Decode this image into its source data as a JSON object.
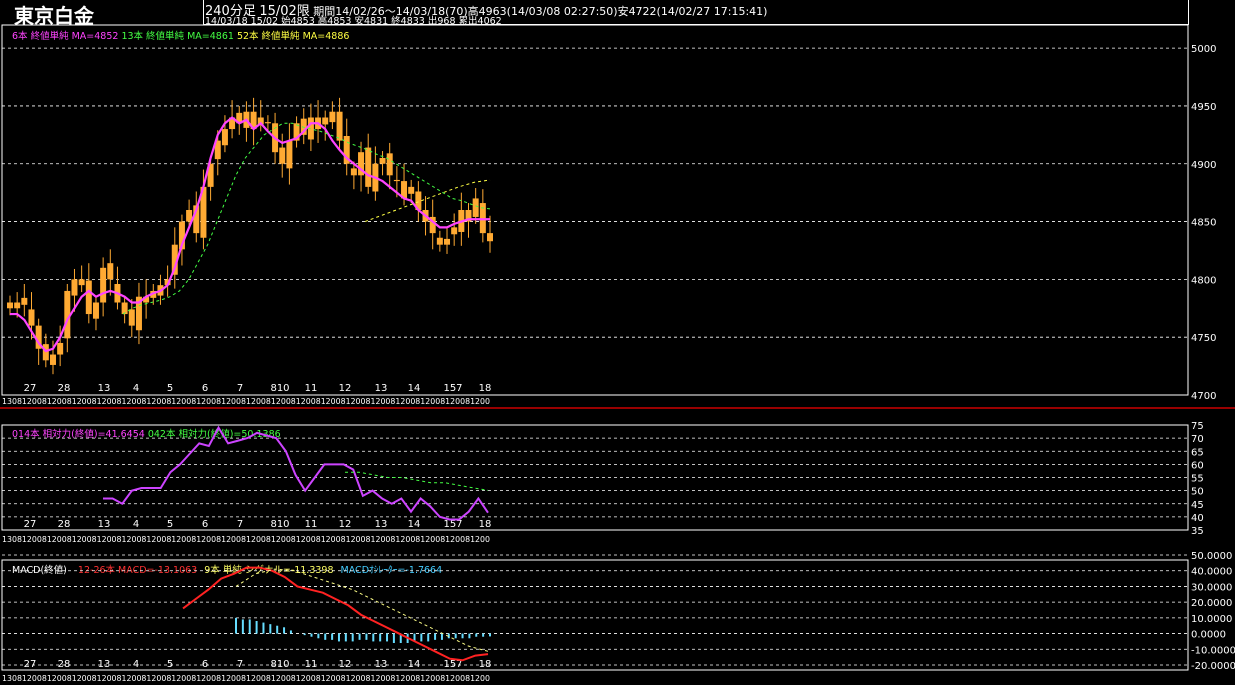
{
  "header": {
    "instrument": "東京白金",
    "timeframe": "240分足",
    "contract": "15/02限",
    "period_info": "期間14/02/26～14/03/18(70)高4963(14/03/08 02:27:50)安4722(14/02/27 17:15:41)",
    "bar_info": "14/03/18 15/02 始4853 高4853 安4831 終4833 出968 累出4062"
  },
  "price_panel": {
    "legend": [
      {
        "text": "6本 終値単純 MA=4852",
        "color": "#ff44ff"
      },
      {
        "text": "13本 終値単純 MA=4861",
        "color": "#44ff44"
      },
      {
        "text": "52本 終値単純 MA=4886",
        "color": "#ffff44"
      }
    ],
    "y_ticks": [
      "5000",
      "4950",
      "4900",
      "4850",
      "4800",
      "4750",
      "4700"
    ]
  },
  "rsi_panel": {
    "legend": [
      {
        "text": "014本 相対力(終値)=41.6454",
        "color": "#ff44ff"
      },
      {
        "text": "042本 相対力(終値)=50.1386",
        "color": "#44ff44"
      }
    ],
    "y_ticks": [
      "75",
      "70",
      "65",
      "60",
      "55",
      "50",
      "45",
      "40",
      "35"
    ]
  },
  "macd_panel": {
    "legend": [
      {
        "text": "MACD(終値)",
        "color": "#ffffff"
      },
      {
        "text": "12-26本 MACD=-13.1063",
        "color": "#ff3333"
      },
      {
        "text": "9本 単純 シグナル=-11.3398",
        "color": "#ffff66"
      },
      {
        "text": "MACDｵｼﾚｰﾀｰ=-1.7664",
        "color": "#44ccff"
      }
    ],
    "y_ticks": [
      "50.0000",
      "40.0000",
      "30.0000",
      "20.0000",
      "10.0000",
      "0.0000",
      "-10.0000",
      "-20.0000"
    ]
  },
  "x_date_labels": [
    "27",
    "28",
    "13",
    "4",
    "5",
    "6",
    "7",
    "810",
    "11",
    "12",
    "13",
    "14",
    "157",
    "18"
  ],
  "x_time_strip": "13081200812008120081200812008120081200812008120081200812008120081200812008120081200812008120081200",
  "colors": {
    "candle": "#ffaa33",
    "ma6": "#ff44ff",
    "ma13": "#44ff44",
    "ma52": "#ffff44",
    "rsi14": "#cc44ff",
    "rsi42": "#44ff44",
    "macd": "#ff2222",
    "signal": "#ffff88",
    "osc": "#66ddff",
    "grid": "#ffffff",
    "separator": "#cc0000"
  },
  "chart_data": [
    {
      "type": "candlestick",
      "title": "東京白金 240分足 15/02限",
      "y_range": [
        4700,
        5020
      ],
      "series": [
        {
          "name": "price_close",
          "values": [
            4775,
            4780,
            4778,
            4760,
            4740,
            4730,
            4735,
            4745,
            4790,
            4800,
            4795,
            4770,
            4780,
            4810,
            4800,
            4780,
            4770,
            4760,
            4785,
            4780,
            4790,
            4795,
            4800,
            4830,
            4850,
            4860,
            4840,
            4880,
            4900,
            4920,
            4930,
            4940,
            4935,
            4945,
            4930,
            4940,
            4935,
            4910,
            4900,
            4920,
            4935,
            4925,
            4940,
            4930,
            4940,
            4945,
            4920,
            4900,
            4890,
            4910,
            4880,
            4900,
            4905,
            4890,
            4885,
            4870,
            4880,
            4860,
            4850,
            4840,
            4830,
            4835,
            4845,
            4860,
            4850,
            4870,
            4840,
            4833
          ]
        },
        {
          "name": "6本 終値単純 MA",
          "values": [
            4770,
            4770,
            4765,
            4755,
            4745,
            4738,
            4740,
            4750,
            4765,
            4775,
            4785,
            4790,
            4785,
            4788,
            4790,
            4788,
            4785,
            4780,
            4780,
            4785,
            4788,
            4790,
            4795,
            4810,
            4830,
            4845,
            4860,
            4880,
            4905,
            4925,
            4935,
            4940,
            4935,
            4938,
            4930,
            4935,
            4928,
            4922,
            4918,
            4920,
            4922,
            4928,
            4935,
            4935,
            4930,
            4920,
            4912,
            4905,
            4900,
            4895,
            4890,
            4888,
            4885,
            4880,
            4875,
            4870,
            4868,
            4860,
            4855,
            4850,
            4845,
            4845,
            4848,
            4850,
            4852,
            4852,
            4852,
            4852
          ]
        },
        {
          "name": "13本 終値単純 MA",
          "values": [
            null,
            null,
            null,
            null,
            null,
            null,
            null,
            null,
            null,
            null,
            null,
            null,
            4770,
            4775,
            4778,
            4780,
            4782,
            4785,
            4790,
            4800,
            4815,
            4830,
            4850,
            4870,
            4890,
            4905,
            4915,
            4925,
            4930,
            4935,
            4935,
            4932,
            4930,
            4928,
            4925,
            4922,
            4918,
            4915,
            4912,
            4908,
            4905,
            4900,
            4895,
            4890,
            4885,
            4880,
            4875,
            4870,
            4868,
            4865,
            4862,
            4861
          ]
        },
        {
          "name": "52本 終値単純 MA",
          "values": [
            4850,
            4855,
            4860,
            4865,
            4870,
            4875,
            4880,
            4884,
            4886
          ]
        }
      ]
    },
    {
      "type": "line",
      "title": "相対力",
      "y_range": [
        35,
        75
      ],
      "series": [
        {
          "name": "014本 相対力(終値)",
          "values": [
            47,
            47,
            45,
            50,
            51,
            51,
            51,
            57,
            60,
            64,
            68,
            67,
            74,
            68,
            69,
            70,
            72,
            71,
            70,
            65,
            56,
            50,
            55,
            60,
            60,
            60,
            58,
            48,
            50,
            47,
            45,
            47,
            42,
            47,
            44,
            40,
            39,
            39,
            42,
            47,
            41.6
          ]
        },
        {
          "name": "042本 相対力(終値)",
          "values": [
            57,
            57,
            56,
            55,
            55,
            54,
            53,
            53,
            52,
            51,
            50.1
          ]
        }
      ]
    },
    {
      "type": "line",
      "title": "MACD(終値)",
      "y_range": [
        -20,
        50
      ],
      "series": [
        {
          "name": "12-26本 MACD",
          "values": [
            16,
            22,
            28,
            35,
            38,
            42,
            42,
            40,
            36,
            30,
            28,
            26,
            22,
            18,
            12,
            8,
            4,
            0,
            -4,
            -8,
            -12,
            -16,
            -17,
            -14,
            -13.1
          ]
        },
        {
          "name": "9本 単純 シグナル",
          "values": [
            30,
            38,
            41,
            40,
            36,
            32,
            28,
            22,
            16,
            10,
            4,
            -2,
            -8,
            -11.3
          ]
        },
        {
          "name": "MACDｵｼﾚｰﾀｰ",
          "values": [
            10,
            9,
            9,
            8,
            7,
            6,
            5,
            4,
            2,
            0,
            -1,
            -2,
            -3,
            -4,
            -4,
            -5,
            -5,
            -5,
            -4,
            -4,
            -5,
            -5,
            -5,
            -6,
            -6,
            -6,
            -5,
            -5,
            -5,
            -4,
            -4,
            -3,
            -3,
            -3,
            -3,
            -2,
            -2,
            -1.8
          ]
        }
      ]
    }
  ]
}
